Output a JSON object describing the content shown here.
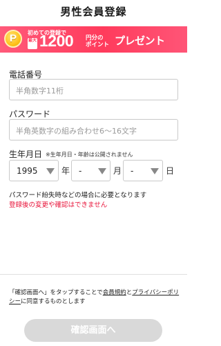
{
  "header": {
    "title": "男性会員登録"
  },
  "banner": {
    "coin_letter": "P",
    "line1": "初めての登録で",
    "max_badge": "最大",
    "amount": "1200",
    "unit_line1": "円分の",
    "unit_line2": "ポイント",
    "present": "プレゼント"
  },
  "phone": {
    "label": "電話番号",
    "placeholder": "半角数字11桁"
  },
  "password": {
    "label": "パスワード",
    "placeholder": "半角英数字の組み合わせ6〜16文字"
  },
  "birthday": {
    "label": "生年月日",
    "note": "※生年月日・年齢は公開されません",
    "year_value": "1995",
    "year_unit": "年",
    "month_value": "-",
    "month_unit": "月",
    "day_value": "-",
    "day_unit": "日"
  },
  "info_text": "パスワード紛失時などの場合に必要となります",
  "warning_text": "登録後の変更や確認はできません",
  "agreement": {
    "prefix": "「確認画面へ」をタップすることで",
    "terms_link": "会員規約",
    "conjunction": "と",
    "privacy_link": "プライバシーポリシー",
    "suffix": "に同意するものとします"
  },
  "confirm_button": "確認画面へ",
  "colors": {
    "banner": "#ff3b5c",
    "warning": "#e8143a",
    "button_disabled": "#d9d9d9"
  }
}
